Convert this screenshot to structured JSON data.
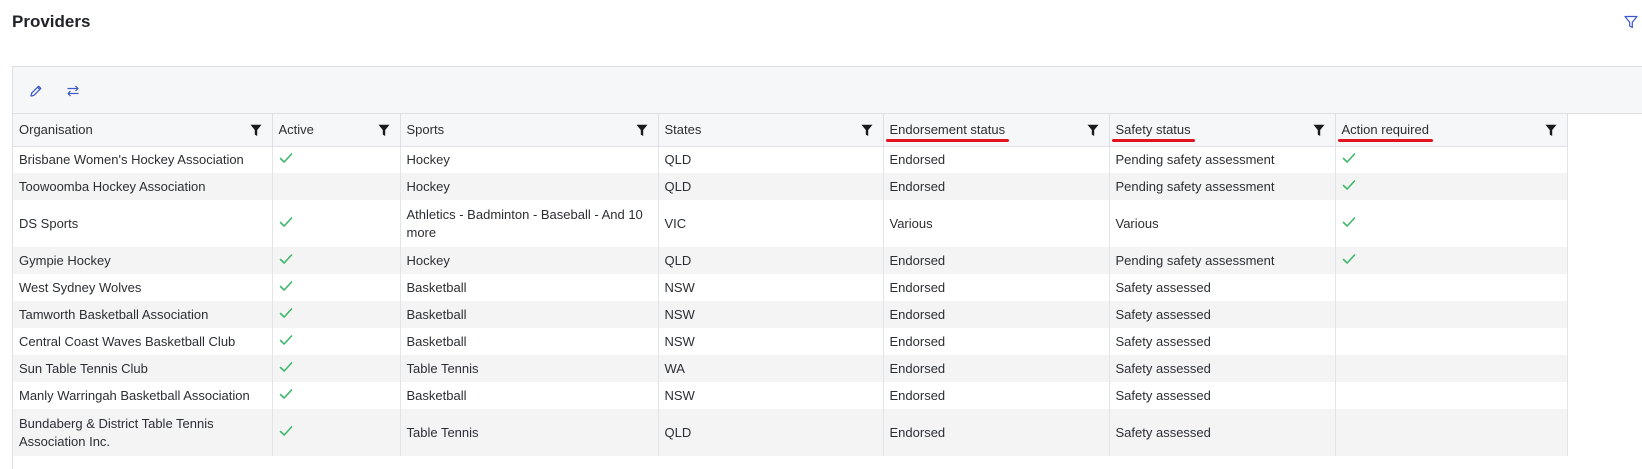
{
  "page": {
    "title": "Providers"
  },
  "colors": {
    "check": "#3fb86b",
    "header_underline": "#e0141e",
    "icon_blue": "#3a56c8"
  },
  "toolbar": {
    "icons": [
      "pencil-icon",
      "swap-arrows-icon"
    ]
  },
  "columns": [
    {
      "key": "organisation",
      "label": "Organisation",
      "underlined": false
    },
    {
      "key": "active",
      "label": "Active",
      "underlined": false
    },
    {
      "key": "sports",
      "label": "Sports",
      "underlined": false
    },
    {
      "key": "states",
      "label": "States",
      "underlined": false
    },
    {
      "key": "endorsement",
      "label": "Endorsement status",
      "underlined": true
    },
    {
      "key": "safety",
      "label": "Safety status",
      "underlined": true
    },
    {
      "key": "action",
      "label": "Action required",
      "underlined": true
    }
  ],
  "rows": [
    {
      "organisation": "Brisbane Women's Hockey Association",
      "active": true,
      "sports": "Hockey",
      "states": "QLD",
      "endorsement": "Endorsed",
      "safety": "Pending safety assessment",
      "action": true
    },
    {
      "organisation": "Toowoomba Hockey Association",
      "active": false,
      "sports": "Hockey",
      "states": "QLD",
      "endorsement": "Endorsed",
      "safety": "Pending safety assessment",
      "action": true
    },
    {
      "organisation": "DS Sports",
      "active": true,
      "sports": "Athletics - Badminton - Baseball - And 10 more",
      "states": "VIC",
      "endorsement": "Various",
      "safety": "Various",
      "action": true
    },
    {
      "organisation": "Gympie Hockey",
      "active": true,
      "sports": "Hockey",
      "states": "QLD",
      "endorsement": "Endorsed",
      "safety": "Pending safety assessment",
      "action": true
    },
    {
      "organisation": "West Sydney Wolves",
      "active": true,
      "sports": "Basketball",
      "states": "NSW",
      "endorsement": "Endorsed",
      "safety": "Safety assessed",
      "action": false
    },
    {
      "organisation": "Tamworth Basketball Association",
      "active": true,
      "sports": "Basketball",
      "states": "NSW",
      "endorsement": "Endorsed",
      "safety": "Safety assessed",
      "action": false
    },
    {
      "organisation": "Central Coast Waves Basketball Club",
      "active": true,
      "sports": "Basketball",
      "states": "NSW",
      "endorsement": "Endorsed",
      "safety": "Safety assessed",
      "action": false
    },
    {
      "organisation": "Sun Table Tennis Club",
      "active": true,
      "sports": "Table Tennis",
      "states": "WA",
      "endorsement": "Endorsed",
      "safety": "Safety assessed",
      "action": false
    },
    {
      "organisation": "Manly Warringah Basketball Association",
      "active": true,
      "sports": "Basketball",
      "states": "NSW",
      "endorsement": "Endorsed",
      "safety": "Safety assessed",
      "action": false
    },
    {
      "organisation": "Bundaberg & District Table Tennis Association Inc.",
      "active": true,
      "sports": "Table Tennis",
      "states": "QLD",
      "endorsement": "Endorsed",
      "safety": "Safety assessed",
      "action": false
    }
  ]
}
